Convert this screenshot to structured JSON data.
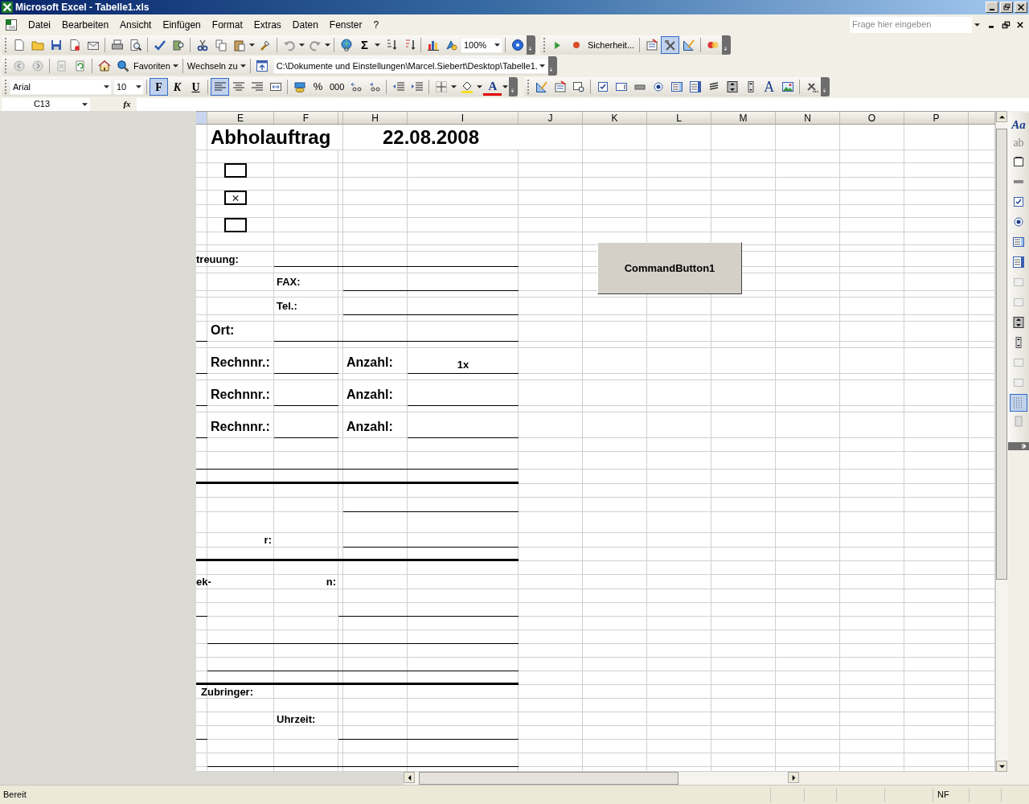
{
  "window": {
    "title": "Microsoft Excel - Tabelle1.xls"
  },
  "menu_bar": {
    "items": [
      "Datei",
      "Bearbeiten",
      "Ansicht",
      "Einfügen",
      "Format",
      "Extras",
      "Daten",
      "Fenster",
      "?"
    ],
    "help_placeholder": "Frage hier eingeben"
  },
  "standard_toolbar": {
    "sum_glyph": "Σ",
    "zoom": "100%"
  },
  "visual_basic_toolbar": {
    "security_button": "Sicherheit...",
    "design_mode": {
      "selected": true
    }
  },
  "web_toolbar": {
    "favorites": "Favoriten",
    "switch_to": "Wechseln zu",
    "address": "C:\\Dokumente und Einstellungen\\Marcel.Siebert\\Desktop\\Tabelle1."
  },
  "formatting_toolbar": {
    "font": "Arial",
    "size": "10",
    "styles": [
      {
        "label": "F",
        "selected": true
      },
      {
        "label": "K",
        "selected": false
      },
      {
        "label": "U",
        "selected": false
      }
    ],
    "alignment": [
      {
        "selected": true
      },
      {
        "selected": false
      },
      {
        "selected": false
      }
    ],
    "percent": "%",
    "thousands": "000",
    "font_color_glyph": "A"
  },
  "control_toolbox": {
    "label_glyph": "A"
  },
  "formula_bar": {
    "name_box": "C13",
    "fx": "fx"
  },
  "sheet": {
    "column_headers": [
      "E",
      "F",
      "H",
      "I",
      "J",
      "K",
      "L",
      "M",
      "N",
      "O",
      "P"
    ],
    "cells": [
      {
        "kind": "title",
        "text": "Abholauftrag"
      },
      {
        "kind": "title",
        "text": "22.08.2008"
      },
      {
        "kind": "checkbox",
        "checked": false
      },
      {
        "kind": "checkbox",
        "checked": true
      },
      {
        "kind": "checkbox",
        "checked": false
      },
      {
        "kind": "label",
        "text": "treuung:"
      },
      {
        "kind": "label",
        "text": "FAX:"
      },
      {
        "kind": "label",
        "text": "Tel.:"
      },
      {
        "kind": "heading",
        "text": "Ort:"
      },
      {
        "kind": "heading",
        "text": "Rechnnr.:"
      },
      {
        "kind": "heading",
        "text": "Anzahl:"
      },
      {
        "kind": "label",
        "text": "1x"
      },
      {
        "kind": "heading",
        "text": "Rechnnr.:"
      },
      {
        "kind": "heading",
        "text": "Anzahl:"
      },
      {
        "kind": "heading",
        "text": "Rechnnr.:"
      },
      {
        "kind": "heading",
        "text": "Anzahl:"
      },
      {
        "kind": "label",
        "text": "r:"
      },
      {
        "kind": "label",
        "text": "ek-"
      },
      {
        "kind": "label",
        "text": "n:"
      },
      {
        "kind": "label",
        "text": "Zubringer:"
      },
      {
        "kind": "label",
        "text": "Uhrzeit:"
      }
    ],
    "command_button": "CommandButton1"
  },
  "side_toolbar": {
    "glyphs": [
      "Aa",
      "ab"
    ],
    "grid_toggle": {
      "selected": true
    }
  },
  "status_bar": {
    "text": "Bereit",
    "indicator": "NF"
  }
}
